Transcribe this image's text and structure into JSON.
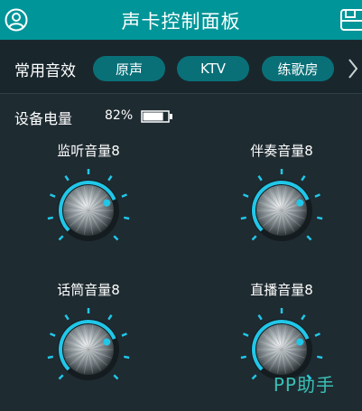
{
  "header": {
    "title": "声卡控制面板",
    "left_icon": "user-icon",
    "right_icon": "save-icon"
  },
  "effects": {
    "label": "常用音效",
    "presets": [
      "原声",
      "KTV",
      "练歌房"
    ],
    "more_icon": "chevron-right-icon"
  },
  "device": {
    "battery_label": "设备电量",
    "battery_percent_text": "82%",
    "battery_level": 0.82
  },
  "knobs": [
    {
      "label": "监听音量8",
      "value": 8
    },
    {
      "label": "伴奏音量8",
      "value": 8
    },
    {
      "label": "话筒音量8",
      "value": 8
    },
    {
      "label": "直播音量8",
      "value": 8
    }
  ],
  "watermark": "PP助手",
  "colors": {
    "header_bg": "#009598",
    "page_bg": "#1e2b31",
    "pill_bg": "#0a7078",
    "accent": "#21c7e8"
  }
}
